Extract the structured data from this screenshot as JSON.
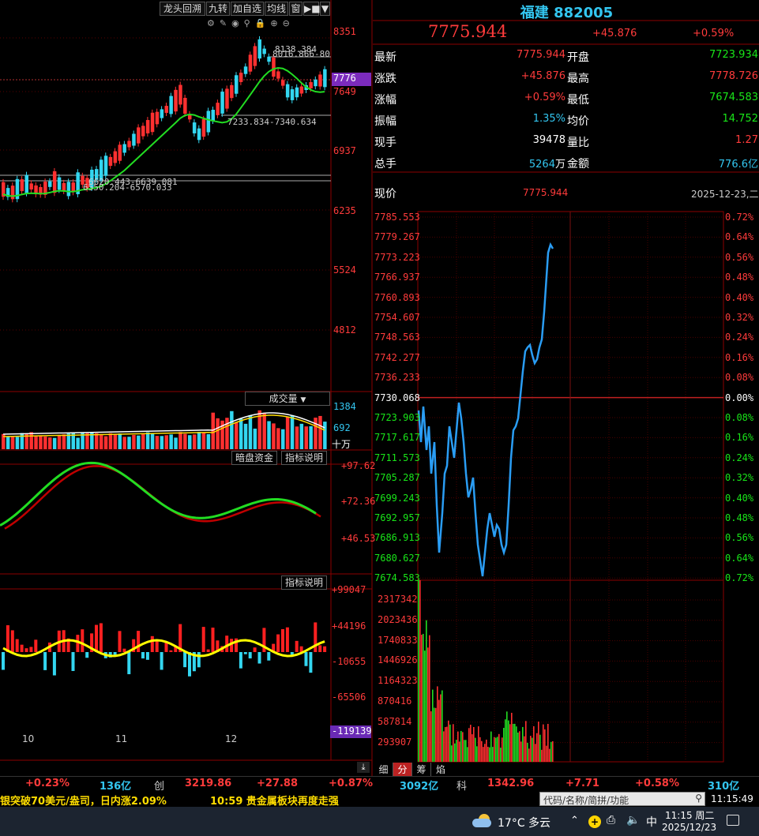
{
  "toolbar": {
    "buttons": [
      "龙头回溯",
      "九转",
      "加自选",
      "均线",
      "窗",
      "▶■",
      "▼"
    ]
  },
  "title": {
    "name": "福建",
    "code": "882005"
  },
  "headline": {
    "price": "7775.944",
    "change": "+45.876",
    "pct": "+0.59%"
  },
  "quote": [
    {
      "l1": "最新",
      "v1": "7775.944",
      "c1": "red",
      "l2": "开盘",
      "v2": "7723.934",
      "c2": "green"
    },
    {
      "l1": "涨跌",
      "v1": "+45.876",
      "c1": "red",
      "l2": "最高",
      "v2": "7778.726",
      "c2": "red"
    },
    {
      "l1": "涨幅",
      "v1": "+0.59%",
      "c1": "red",
      "l2": "最低",
      "v2": "7674.583",
      "c2": "green"
    },
    {
      "l1": "振幅",
      "v1": "1.35%",
      "c1": "cyan",
      "l2": "均价",
      "v2": "14.752",
      "c2": "green"
    },
    {
      "l1": "现手",
      "v1": "39478",
      "c1": "white",
      "l2": "量比",
      "v2": "1.27",
      "c2": "red"
    },
    {
      "l1": "总手",
      "v1": "5264",
      "unit1": "万",
      "c1": "cyan",
      "l2": "金额",
      "v2": "776.6亿",
      "c2": "cyan"
    }
  ],
  "current": {
    "label": "现价",
    "value": "7775.944",
    "date": "2025-12-23,二"
  },
  "kline": {
    "price_axis": [
      "8351",
      "7776",
      "7649",
      "6937",
      "6235",
      "5524",
      "4812"
    ],
    "annotations": [
      "8138.384",
      "8016.866-80",
      "7233.834-7340.634",
      "6620.443-6639.081",
      "6550.204-6570.033"
    ],
    "months": [
      "10",
      "11",
      "12"
    ]
  },
  "volume": {
    "title": "成交量",
    "axis": [
      "1384",
      "692",
      "十万"
    ]
  },
  "indicator1": {
    "btn_a": "暗盘资金",
    "btn_b": "指标说明",
    "axis": [
      "+97.62",
      "+72.36",
      "+46.53"
    ]
  },
  "indicator2": {
    "btn": "指标说明",
    "axis": [
      "+99047",
      "+44196",
      "-10655",
      "-65506",
      "-119139"
    ]
  },
  "intraday": {
    "price_axis": [
      "7785.553",
      "7779.267",
      "7773.223",
      "7766.937",
      "7760.893",
      "7754.607",
      "7748.563",
      "7742.277",
      "7736.233",
      "7730.068",
      "7723.903",
      "7717.617",
      "7711.573",
      "7705.287",
      "7699.243",
      "7692.957",
      "7686.913",
      "7680.627",
      "7674.583"
    ],
    "pct_axis": [
      "0.72%",
      "0.64%",
      "0.56%",
      "0.48%",
      "0.40%",
      "0.32%",
      "0.24%",
      "0.16%",
      "0.08%",
      "0.00%",
      "0.08%",
      "0.16%",
      "0.24%",
      "0.32%",
      "0.40%",
      "0.48%",
      "0.56%",
      "0.64%",
      "0.72%"
    ],
    "vol_axis": [
      "2317342",
      "2023436",
      "1740833",
      "1446926",
      "1164323",
      "870416",
      "587814",
      "293907"
    ],
    "tabs": [
      "细",
      "分",
      "筹",
      "焰"
    ]
  },
  "status_bar": {
    "left_pct": "+0.23%",
    "left_amt": "136亿",
    "idx_name": "创",
    "idx_val": "3219.86",
    "idx_chg": "+27.88",
    "idx_pct": "+0.87%",
    "idx_amt": "3092亿",
    "idx2_name": "科",
    "idx2_val": "1342.96",
    "idx2_chg": "+7.71",
    "idx2_pct": "+0.58%",
    "idx2_amt": "310亿"
  },
  "ticker": {
    "news1": "银突破70美元/盎司，日内涨2.09%",
    "news2": "10:59 贵金属板块再度走强",
    "search_placeholder": "代码/名称/简拼/功能",
    "time": "11:15:49"
  },
  "taskbar": {
    "weather": "17°C 多云",
    "ime": "中",
    "clock_time": "11:15 周二",
    "clock_date": "2025/12/23"
  }
}
